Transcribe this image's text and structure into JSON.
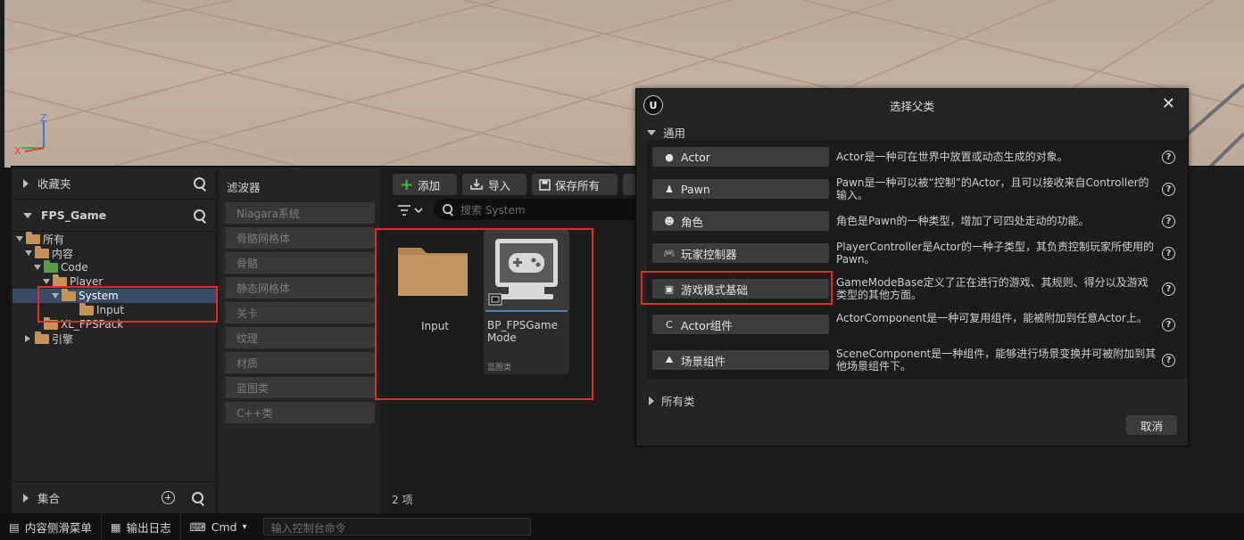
{
  "viewport": {
    "axis_z": "Z",
    "axis_x": "X"
  },
  "left_panel": {
    "favorites_label": "收藏夹",
    "project_label": "FPS_Game",
    "tree": [
      {
        "label": "所有",
        "depth": 0,
        "state": "open"
      },
      {
        "label": "内容",
        "depth": 1,
        "state": "open"
      },
      {
        "label": "Code",
        "depth": 2,
        "state": "open"
      },
      {
        "label": "Player",
        "depth": 3,
        "state": "open"
      },
      {
        "label": "System",
        "depth": 4,
        "state": "open"
      },
      {
        "label": "Input",
        "depth": 5,
        "state": "none"
      },
      {
        "label": "XL_FPSPack",
        "depth": 2,
        "state": "none"
      },
      {
        "label": "引擎",
        "depth": 1,
        "state": "closed"
      }
    ],
    "collections_label": "集合"
  },
  "filter_panel": {
    "title": "滤波器",
    "items": [
      "Niagara系统",
      "骨骼网格体",
      "骨骼",
      "静态网格体",
      "关卡",
      "纹理",
      "材质",
      "蓝图类",
      "C++类"
    ]
  },
  "toolbar": {
    "add_label": "添加",
    "import_label": "导入",
    "save_all_label": "保存所有",
    "search_placeholder": "搜索 System"
  },
  "assets": {
    "items": [
      {
        "label": "Input",
        "type": "folder"
      },
      {
        "label": "BP_FPSGame Mode",
        "type": "blueprint",
        "sublabel": "蓝图类"
      }
    ],
    "count_label": "2 项"
  },
  "status_bar": {
    "content_drawer": "内容侧滑菜单",
    "output_log": "输出日志",
    "cmd_label": "Cmd",
    "console_placeholder": "输入控制台命令"
  },
  "dialog": {
    "title": "选择父类",
    "section_common": "通用",
    "classes": [
      {
        "label": "Actor",
        "icon": "actor-icon",
        "desc": "Actor是一种可在世界中放置或动态生成的对象。"
      },
      {
        "label": "Pawn",
        "icon": "pawn-icon",
        "desc": "Pawn是一种可以被“控制”的Actor，且可以接收来自Controller的输入。"
      },
      {
        "label": "角色",
        "icon": "character-icon",
        "desc": "角色是Pawn的一种类型，增加了可四处走动的功能。"
      },
      {
        "label": "玩家控制器",
        "icon": "gamepad-icon",
        "desc": "PlayerController是Actor的一种子类型，其负责控制玩家所使用的Pawn。"
      },
      {
        "label": "游戏模式基础",
        "icon": "gamemode-icon",
        "desc": "GameModeBase定义了正在进行的游戏、其规则、得分以及游戏类型的其他方面。"
      },
      {
        "label": "Actor组件",
        "icon": "component-icon",
        "desc": "ActorComponent是一种可复用组件，能被附加到任意Actor上。"
      },
      {
        "label": "场景组件",
        "icon": "scene-component-icon",
        "desc": "SceneComponent是一种组件，能够进行场景变换并可被附加到其他场景组件下。"
      }
    ],
    "section_all": "所有类",
    "cancel_label": "取消"
  }
}
